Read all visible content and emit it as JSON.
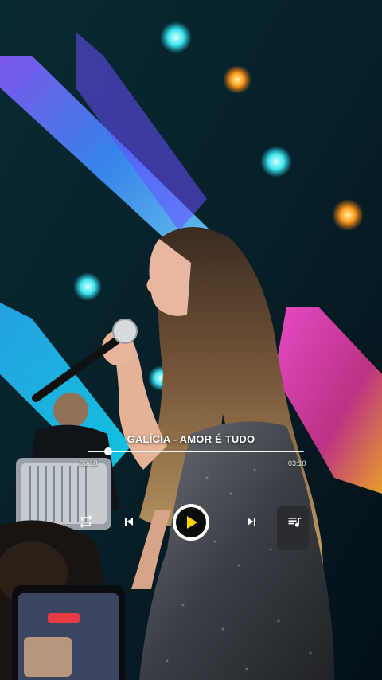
{
  "player": {
    "track_title": "GALÍCIA - AMOR É TUDO",
    "current_time": "00:18",
    "total_time": "03:10",
    "progress": 0.095
  },
  "icons": {
    "repeat": "repeat-icon",
    "previous": "skip-previous-icon",
    "play": "play-icon",
    "next": "skip-next-icon",
    "queue": "playlist-icon"
  },
  "colors": {
    "accent": "#ffd400",
    "text": "#ffffff",
    "play_ring": "#ffffff",
    "play_fill": "#0b0b0b"
  }
}
